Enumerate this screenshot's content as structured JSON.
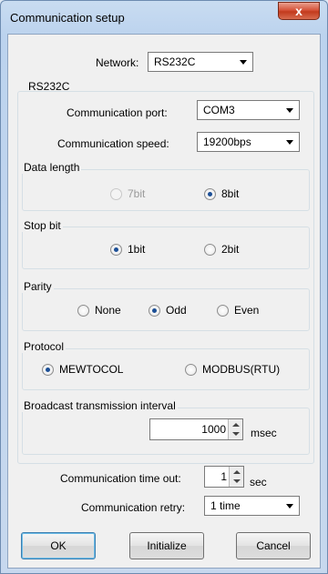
{
  "window": {
    "title": "Communication setup",
    "close_glyph": "x"
  },
  "network": {
    "label": "Network:",
    "value": "RS232C"
  },
  "rs232c": {
    "title": "RS232C",
    "port_label": "Communication port:",
    "port_value": "COM3",
    "speed_label": "Communication speed:",
    "speed_value": "19200bps"
  },
  "data_length": {
    "title": "Data length",
    "opt1": "7bit",
    "opt2": "8bit"
  },
  "stop_bit": {
    "title": "Stop bit",
    "opt1": "1bit",
    "opt2": "2bit"
  },
  "parity": {
    "title": "Parity",
    "opt1": "None",
    "opt2": "Odd",
    "opt3": "Even"
  },
  "protocol": {
    "title": "Protocol",
    "opt1": "MEWTOCOL",
    "opt2": "MODBUS(RTU)"
  },
  "broadcast": {
    "title": "Broadcast transmission interval",
    "value": "1000",
    "unit": "msec"
  },
  "timeout": {
    "label": "Communication time out:",
    "value": "1",
    "unit": "sec"
  },
  "retry": {
    "label": "Communication retry:",
    "value": "1 time"
  },
  "buttons": {
    "ok": "OK",
    "initialize": "Initialize",
    "cancel": "Cancel"
  }
}
